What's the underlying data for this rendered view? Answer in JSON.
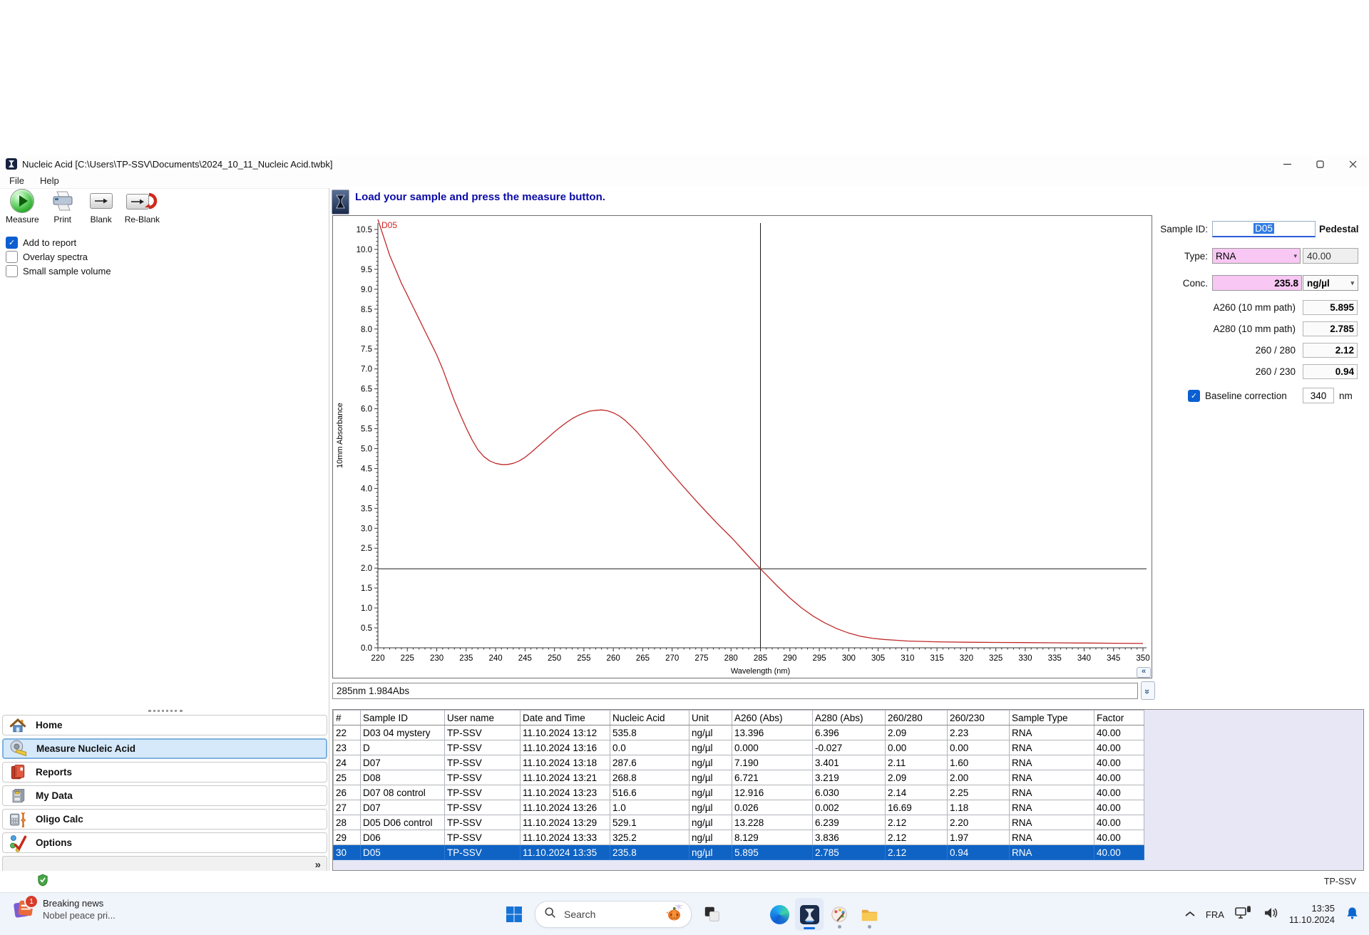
{
  "window": {
    "title": "Nucleic Acid  [C:\\Users\\TP-SSV\\Documents\\2024_10_11_Nucleic Acid.twbk]"
  },
  "menu": {
    "items": [
      "File",
      "Help"
    ]
  },
  "toolbar": {
    "buttons": [
      {
        "label": "Measure",
        "icon": "measure-play-icon"
      },
      {
        "label": "Print",
        "icon": "printer-icon"
      },
      {
        "label": "Blank",
        "icon": "blank-icon"
      },
      {
        "label": "Re-Blank",
        "icon": "reblank-icon"
      }
    ]
  },
  "options_checkboxes": [
    {
      "label": "Add to report",
      "checked": true
    },
    {
      "label": "Overlay spectra",
      "checked": false
    },
    {
      "label": "Small sample volume",
      "checked": false
    }
  ],
  "message_bar": {
    "text": "Load your sample and press the measure button."
  },
  "status_readout": "285nm 1.984Abs",
  "sample_panel": {
    "sample_id_label": "Sample ID:",
    "sample_id_value": "D05",
    "mode_label": "Pedestal",
    "type_label": "Type:",
    "type_value": "RNA",
    "factor_value": "40.00",
    "conc_label": "Conc.",
    "conc_value": "235.8",
    "conc_unit": "ng/µl",
    "readings": [
      {
        "label": "A260 (10 mm path)",
        "value": "5.895"
      },
      {
        "label": "A280 (10 mm path)",
        "value": "2.785"
      },
      {
        "label": "260 / 280",
        "value": "2.12"
      },
      {
        "label": "260 / 230",
        "value": "0.94"
      }
    ],
    "baseline": {
      "label": "Baseline correction",
      "checked": true,
      "value": "340",
      "unit": "nm"
    }
  },
  "results_table": {
    "headers": [
      "#",
      "Sample ID",
      "User name",
      "Date and Time",
      "Nucleic Acid",
      "Unit",
      "A260 (Abs)",
      "A280 (Abs)",
      "260/280",
      "260/230",
      "Sample Type",
      "Factor"
    ],
    "rows": [
      [
        "22",
        "D03 04 mystery",
        "TP-SSV",
        "11.10.2024 13:12",
        "535.8",
        "ng/µl",
        "13.396",
        "6.396",
        "2.09",
        "2.23",
        "RNA",
        "40.00"
      ],
      [
        "23",
        "D",
        "TP-SSV",
        "11.10.2024 13:16",
        "0.0",
        "ng/µl",
        "0.000",
        "-0.027",
        "0.00",
        "0.00",
        "RNA",
        "40.00"
      ],
      [
        "24",
        "D07",
        "TP-SSV",
        "11.10.2024 13:18",
        "287.6",
        "ng/µl",
        "7.190",
        "3.401",
        "2.11",
        "1.60",
        "RNA",
        "40.00"
      ],
      [
        "25",
        "D08",
        "TP-SSV",
        "11.10.2024 13:21",
        "268.8",
        "ng/µl",
        "6.721",
        "3.219",
        "2.09",
        "2.00",
        "RNA",
        "40.00"
      ],
      [
        "26",
        "D07 08 control",
        "TP-SSV",
        "11.10.2024 13:23",
        "516.6",
        "ng/µl",
        "12.916",
        "6.030",
        "2.14",
        "2.25",
        "RNA",
        "40.00"
      ],
      [
        "27",
        "D07",
        "TP-SSV",
        "11.10.2024 13:26",
        "1.0",
        "ng/µl",
        "0.026",
        "0.002",
        "16.69",
        "1.18",
        "RNA",
        "40.00"
      ],
      [
        "28",
        "D05 D06 control",
        "TP-SSV",
        "11.10.2024 13:29",
        "529.1",
        "ng/µl",
        "13.228",
        "6.239",
        "2.12",
        "2.20",
        "RNA",
        "40.00"
      ],
      [
        "29",
        "D06",
        "TP-SSV",
        "11.10.2024 13:33",
        "325.2",
        "ng/µl",
        "8.129",
        "3.836",
        "2.12",
        "1.97",
        "RNA",
        "40.00"
      ],
      [
        "30",
        "D05",
        "TP-SSV",
        "11.10.2024 13:35",
        "235.8",
        "ng/µl",
        "5.895",
        "2.785",
        "2.12",
        "0.94",
        "RNA",
        "40.00"
      ]
    ],
    "selected_row": "30"
  },
  "sidebar": {
    "items": [
      {
        "label": "Home",
        "icon": "home-icon",
        "selected": false
      },
      {
        "label": "Measure Nucleic Acid",
        "icon": "measure-tape-icon",
        "selected": true
      },
      {
        "label": "Reports",
        "icon": "reports-icon",
        "selected": false
      },
      {
        "label": "My Data",
        "icon": "my-data-icon",
        "selected": false
      },
      {
        "label": "Oligo Calc",
        "icon": "oligo-calc-icon",
        "selected": false
      },
      {
        "label": "Options",
        "icon": "options-icon",
        "selected": false
      }
    ]
  },
  "footer": {
    "user": "TP-SSV"
  },
  "taskbar": {
    "news": {
      "title": "Breaking news",
      "subtitle": "Nobel peace pri...",
      "badge": "1"
    },
    "search_label": "Search",
    "language": "FRA",
    "time": "13:35",
    "date": "11.10.2024"
  },
  "chart_data": {
    "type": "line",
    "series_label": "D05",
    "xlabel": "Wavelength (nm)",
    "ylabel": "10mm Absorbance",
    "xlim": [
      220,
      350
    ],
    "ylim": [
      0,
      10.5
    ],
    "x_tick_step": 5,
    "y_tick_step": 0.5,
    "legend_position": "none",
    "grid": false,
    "crosshair": {
      "x": 285,
      "y": 1.984
    },
    "line_color": "#c02a2a",
    "points": [
      [
        220,
        10.75
      ],
      [
        221,
        10.3
      ],
      [
        222,
        9.85
      ],
      [
        223,
        9.5
      ],
      [
        224,
        9.15
      ],
      [
        225,
        8.85
      ],
      [
        226,
        8.55
      ],
      [
        227,
        8.25
      ],
      [
        228,
        7.95
      ],
      [
        229,
        7.65
      ],
      [
        230,
        7.35
      ],
      [
        231,
        7.0
      ],
      [
        232,
        6.6
      ],
      [
        233,
        6.2
      ],
      [
        234,
        5.85
      ],
      [
        235,
        5.52
      ],
      [
        236,
        5.22
      ],
      [
        237,
        4.97
      ],
      [
        238,
        4.8
      ],
      [
        239,
        4.69
      ],
      [
        240,
        4.63
      ],
      [
        241,
        4.6
      ],
      [
        242,
        4.6
      ],
      [
        243,
        4.63
      ],
      [
        244,
        4.69
      ],
      [
        245,
        4.78
      ],
      [
        246,
        4.9
      ],
      [
        247,
        5.03
      ],
      [
        248,
        5.16
      ],
      [
        249,
        5.29
      ],
      [
        250,
        5.42
      ],
      [
        251,
        5.54
      ],
      [
        252,
        5.65
      ],
      [
        253,
        5.75
      ],
      [
        254,
        5.83
      ],
      [
        255,
        5.89
      ],
      [
        256,
        5.94
      ],
      [
        257,
        5.96
      ],
      [
        258,
        5.97
      ],
      [
        259,
        5.95
      ],
      [
        260,
        5.9
      ],
      [
        261,
        5.82
      ],
      [
        262,
        5.71
      ],
      [
        263,
        5.57
      ],
      [
        264,
        5.42
      ],
      [
        265,
        5.25
      ],
      [
        266,
        5.08
      ],
      [
        267,
        4.9
      ],
      [
        268,
        4.72
      ],
      [
        269,
        4.54
      ],
      [
        270,
        4.37
      ],
      [
        272,
        4.03
      ],
      [
        274,
        3.7
      ],
      [
        276,
        3.38
      ],
      [
        278,
        3.07
      ],
      [
        280,
        2.78
      ],
      [
        282,
        2.46
      ],
      [
        284,
        2.14
      ],
      [
        285,
        1.98
      ],
      [
        286,
        1.83
      ],
      [
        288,
        1.53
      ],
      [
        290,
        1.25
      ],
      [
        292,
        1.0
      ],
      [
        294,
        0.79
      ],
      [
        296,
        0.62
      ],
      [
        298,
        0.48
      ],
      [
        300,
        0.37
      ],
      [
        302,
        0.29
      ],
      [
        304,
        0.24
      ],
      [
        306,
        0.21
      ],
      [
        308,
        0.19
      ],
      [
        310,
        0.17
      ],
      [
        315,
        0.15
      ],
      [
        320,
        0.14
      ],
      [
        325,
        0.135
      ],
      [
        330,
        0.13
      ],
      [
        335,
        0.125
      ],
      [
        340,
        0.12
      ],
      [
        345,
        0.115
      ],
      [
        350,
        0.11
      ]
    ]
  }
}
